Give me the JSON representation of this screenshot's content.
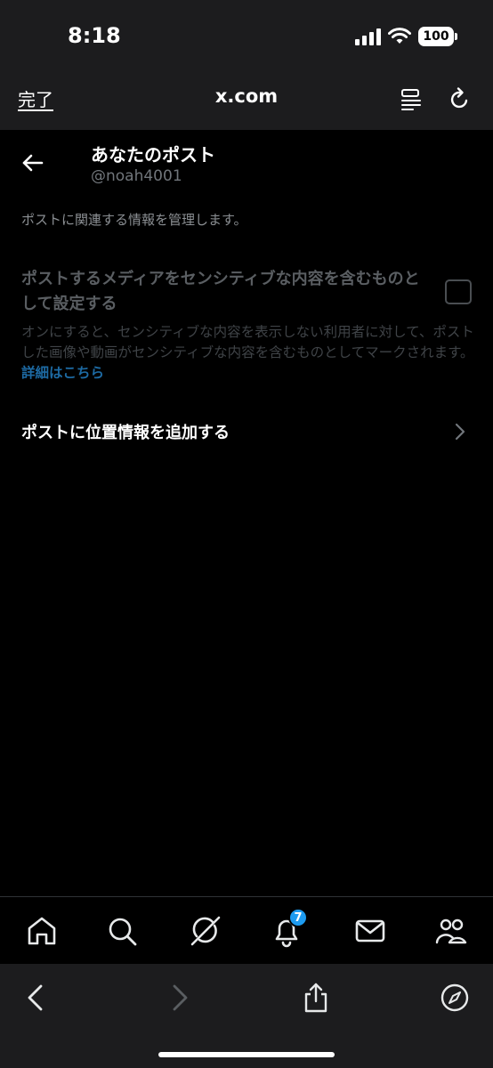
{
  "status_bar": {
    "time": "8:18",
    "battery": "100"
  },
  "browser": {
    "done_label": "完了",
    "domain": "x.com"
  },
  "header": {
    "title": "あなたのポスト",
    "handle": "@noah4001"
  },
  "description": "ポストに関連する情報を管理します。",
  "sensitive": {
    "label": "ポストするメディアをセンシティブな内容を含むものとして設定する",
    "help": "オンにすると、センシティブな内容を表示しない利用者に対して、ポストした画像や動画がセンシティブな内容を含むものとしてマークされます。",
    "link": "詳細はこちら",
    "checked": false
  },
  "location": {
    "label": "ポストに位置情報を追加する"
  },
  "tabs": {
    "items": [
      "home-icon",
      "search-icon",
      "grok-icon",
      "notifications-icon",
      "messages-icon",
      "communities-icon"
    ],
    "notification_count": "7"
  },
  "colors": {
    "accent": "#1d9bf0",
    "background": "#000000",
    "chrome": "#1c1c1e"
  }
}
